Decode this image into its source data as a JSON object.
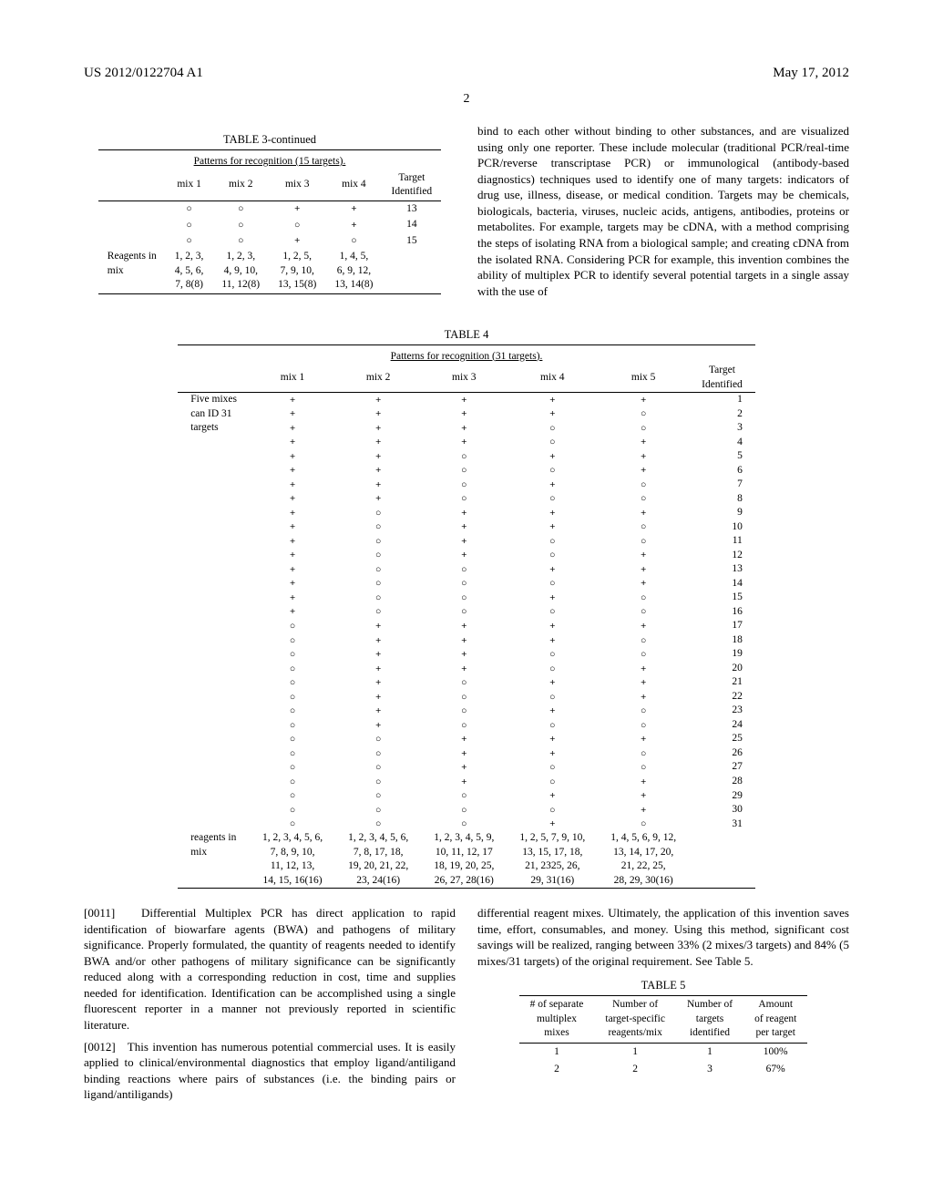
{
  "header": {
    "left": "US 2012/0122704 A1",
    "right": "May 17, 2012"
  },
  "page_number": "2",
  "table3": {
    "title": "TABLE 3-continued",
    "caption": "Patterns for recognition (15 targets).",
    "cols": [
      "mix 1",
      "mix 2",
      "mix 3",
      "mix 4"
    ],
    "target_col": "Target\nIdentified",
    "rows": [
      {
        "m": [
          "○",
          "○",
          "+",
          "+"
        ],
        "t": "13"
      },
      {
        "m": [
          "○",
          "○",
          "○",
          "+"
        ],
        "t": "14"
      },
      {
        "m": [
          "○",
          "○",
          "+",
          "○"
        ],
        "t": "15"
      }
    ],
    "reagents_label": "Reagents in\nmix",
    "reagents": [
      "1, 2, 3,\n4, 5, 6,\n7, 8(8)",
      "1, 2, 3,\n4, 9, 10,\n11, 12(8)",
      "1, 2, 5,\n7, 9, 10,\n13, 15(8)",
      "1, 4, 5,\n6, 9, 12,\n13, 14(8)"
    ]
  },
  "right_col_top_para": "bind to each other without binding to other substances, and are visualized using only one reporter. These include molecular (traditional PCR/real-time PCR/reverse transcriptase PCR) or immunological (antibody-based diagnostics) techniques used to identify one of many targets: indicators of drug use, illness, disease, or medical condition. Targets may be chemicals, biologicals, bacteria, viruses, nucleic acids, antigens, antibodies, proteins or metabolites. For example, targets may be cDNA, with a method comprising the steps of isolating RNA from a biological sample; and creating cDNA from the isolated RNA. Considering PCR for example, this invention combines the ability of multiplex PCR to identify several potential targets in a single assay with the use of",
  "table4": {
    "title": "TABLE 4",
    "caption": "Patterns for recognition (31 targets).",
    "row_label": "Five mixes\ncan ID 31\ntargets",
    "cols": [
      "mix 1",
      "mix 2",
      "mix 3",
      "mix 4",
      "mix 5"
    ],
    "target_col": "Target\nIdentified",
    "reagents_label": "reagents in\nmix",
    "reagents": [
      "1, 2, 3, 4, 5, 6,\n7, 8, 9, 10,\n11, 12, 13,\n14, 15, 16(16)",
      "1, 2, 3, 4, 5, 6,\n7, 8, 17, 18,\n19, 20, 21, 22,\n23, 24(16)",
      "1, 2, 3, 4, 5, 9,\n10, 11, 12, 17\n18, 19, 20, 25,\n26, 27, 28(16)",
      "1, 2, 5, 7, 9, 10,\n13, 15, 17, 18,\n21, 2325, 26,\n29, 31(16)",
      "1, 4, 5, 6, 9, 12,\n13, 14, 17, 20,\n21, 22, 25,\n28, 29, 30(16)"
    ]
  },
  "chart_data": {
    "type": "table",
    "title": "Patterns for recognition (31 targets).",
    "columns": [
      "mix 1",
      "mix 2",
      "mix 3",
      "mix 4",
      "mix 5",
      "Target Identified"
    ],
    "rows": [
      [
        "+",
        "+",
        "+",
        "+",
        "+",
        1
      ],
      [
        "+",
        "+",
        "+",
        "+",
        "○",
        2
      ],
      [
        "+",
        "+",
        "+",
        "○",
        "○",
        3
      ],
      [
        "+",
        "+",
        "+",
        "○",
        "+",
        4
      ],
      [
        "+",
        "+",
        "○",
        "+",
        "+",
        5
      ],
      [
        "+",
        "+",
        "○",
        "○",
        "+",
        6
      ],
      [
        "+",
        "+",
        "○",
        "+",
        "○",
        7
      ],
      [
        "+",
        "+",
        "○",
        "○",
        "○",
        8
      ],
      [
        "+",
        "○",
        "+",
        "+",
        "+",
        9
      ],
      [
        "+",
        "○",
        "+",
        "+",
        "○",
        10
      ],
      [
        "+",
        "○",
        "+",
        "○",
        "○",
        11
      ],
      [
        "+",
        "○",
        "+",
        "○",
        "+",
        12
      ],
      [
        "+",
        "○",
        "○",
        "+",
        "+",
        13
      ],
      [
        "+",
        "○",
        "○",
        "○",
        "+",
        14
      ],
      [
        "+",
        "○",
        "○",
        "+",
        "○",
        15
      ],
      [
        "+",
        "○",
        "○",
        "○",
        "○",
        16
      ],
      [
        "○",
        "+",
        "+",
        "+",
        "+",
        17
      ],
      [
        "○",
        "+",
        "+",
        "+",
        "○",
        18
      ],
      [
        "○",
        "+",
        "+",
        "○",
        "○",
        19
      ],
      [
        "○",
        "+",
        "+",
        "○",
        "+",
        20
      ],
      [
        "○",
        "+",
        "○",
        "+",
        "+",
        21
      ],
      [
        "○",
        "+",
        "○",
        "○",
        "+",
        22
      ],
      [
        "○",
        "+",
        "○",
        "+",
        "○",
        23
      ],
      [
        "○",
        "+",
        "○",
        "○",
        "○",
        24
      ],
      [
        "○",
        "○",
        "+",
        "+",
        "+",
        25
      ],
      [
        "○",
        "○",
        "+",
        "+",
        "○",
        26
      ],
      [
        "○",
        "○",
        "+",
        "○",
        "○",
        27
      ],
      [
        "○",
        "○",
        "+",
        "○",
        "+",
        28
      ],
      [
        "○",
        "○",
        "○",
        "+",
        "+",
        29
      ],
      [
        "○",
        "○",
        "○",
        "○",
        "+",
        30
      ],
      [
        "○",
        "○",
        "○",
        "+",
        "○",
        31
      ]
    ]
  },
  "para11": {
    "num": "[0011]",
    "text": "Differential Multiplex PCR has direct application to rapid identification of biowarfare agents (BWA) and pathogens of military significance. Properly formulated, the quantity of reagents needed to identify BWA and/or other pathogens of military significance can be significantly reduced along with a corresponding reduction in cost, time and supplies needed for identification. Identification can be accomplished using a single fluorescent reporter in a manner not previously reported in scientific literature."
  },
  "para12": {
    "num": "[0012]",
    "text": "This invention has numerous potential commercial uses. It is easily applied to clinical/environmental diagnostics that employ ligand/antiligand binding reactions where pairs of substances (i.e. the binding pairs or ligand/antiligands)"
  },
  "right_after_t4_para": "differential reagent mixes. Ultimately, the application of this invention saves time, effort, consumables, and money. Using this method, significant cost savings will be realized, ranging between 33% (2 mixes/3 targets) and 84% (5 mixes/31 targets) of the original requirement. See Table 5.",
  "table5": {
    "title": "TABLE 5",
    "cols": [
      "# of separate\nmultiplex\nmixes",
      "Number of\ntarget-specific\nreagents/mix",
      "Number of\ntargets\nidentified",
      "Amount\nof reagent\nper target"
    ],
    "rows": [
      [
        "1",
        "1",
        "1",
        "100%"
      ],
      [
        "2",
        "2",
        "3",
        "67%"
      ]
    ]
  }
}
